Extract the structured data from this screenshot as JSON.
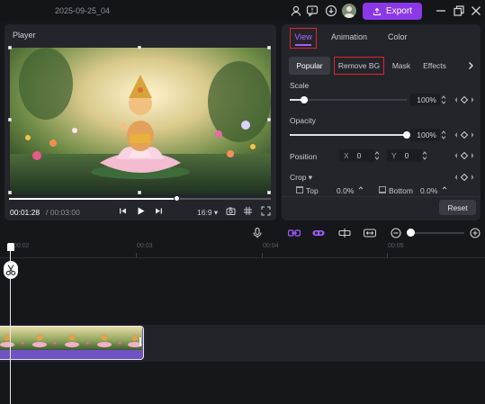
{
  "header": {
    "project_title": "2025-09-25_04",
    "export_label": "Export",
    "icons": [
      "user-icon",
      "feedback-icon",
      "download-icon",
      "avatar",
      "export-icon",
      "minimize-icon",
      "restore-icon",
      "close-icon"
    ],
    "accent_color": "#8d38e8"
  },
  "player": {
    "title": "Player",
    "time_current": "00:01:28",
    "time_total": "/ 00:03:00",
    "aspect_ratio": "16:9 ▾",
    "progress": 0.64
  },
  "properties": {
    "tabs": [
      "View",
      "Animation",
      "Color"
    ],
    "active_tab": "View",
    "subtabs": [
      "Popular",
      "Remove BG",
      "Mask",
      "Effects"
    ],
    "active_subtab": "Popular",
    "scale": {
      "label": "Scale",
      "value": "100%",
      "level": 0.12
    },
    "opacity": {
      "label": "Opacity",
      "value": "100%",
      "level": 1.0
    },
    "position": {
      "label": "Position",
      "x_label": "X",
      "x_value": "0",
      "y_label": "Y",
      "y_value": "0"
    },
    "crop": {
      "label": "Crop ▾",
      "top_label": "Top",
      "top_value": "0.0%",
      "bottom_label": "Bottom",
      "bottom_value": "0.0%"
    },
    "reset_label": "Reset"
  },
  "timeline": {
    "ruler_labels": [
      "00:02",
      "00:03",
      "00:04",
      "00:05"
    ],
    "zoom_level": 0.05
  }
}
